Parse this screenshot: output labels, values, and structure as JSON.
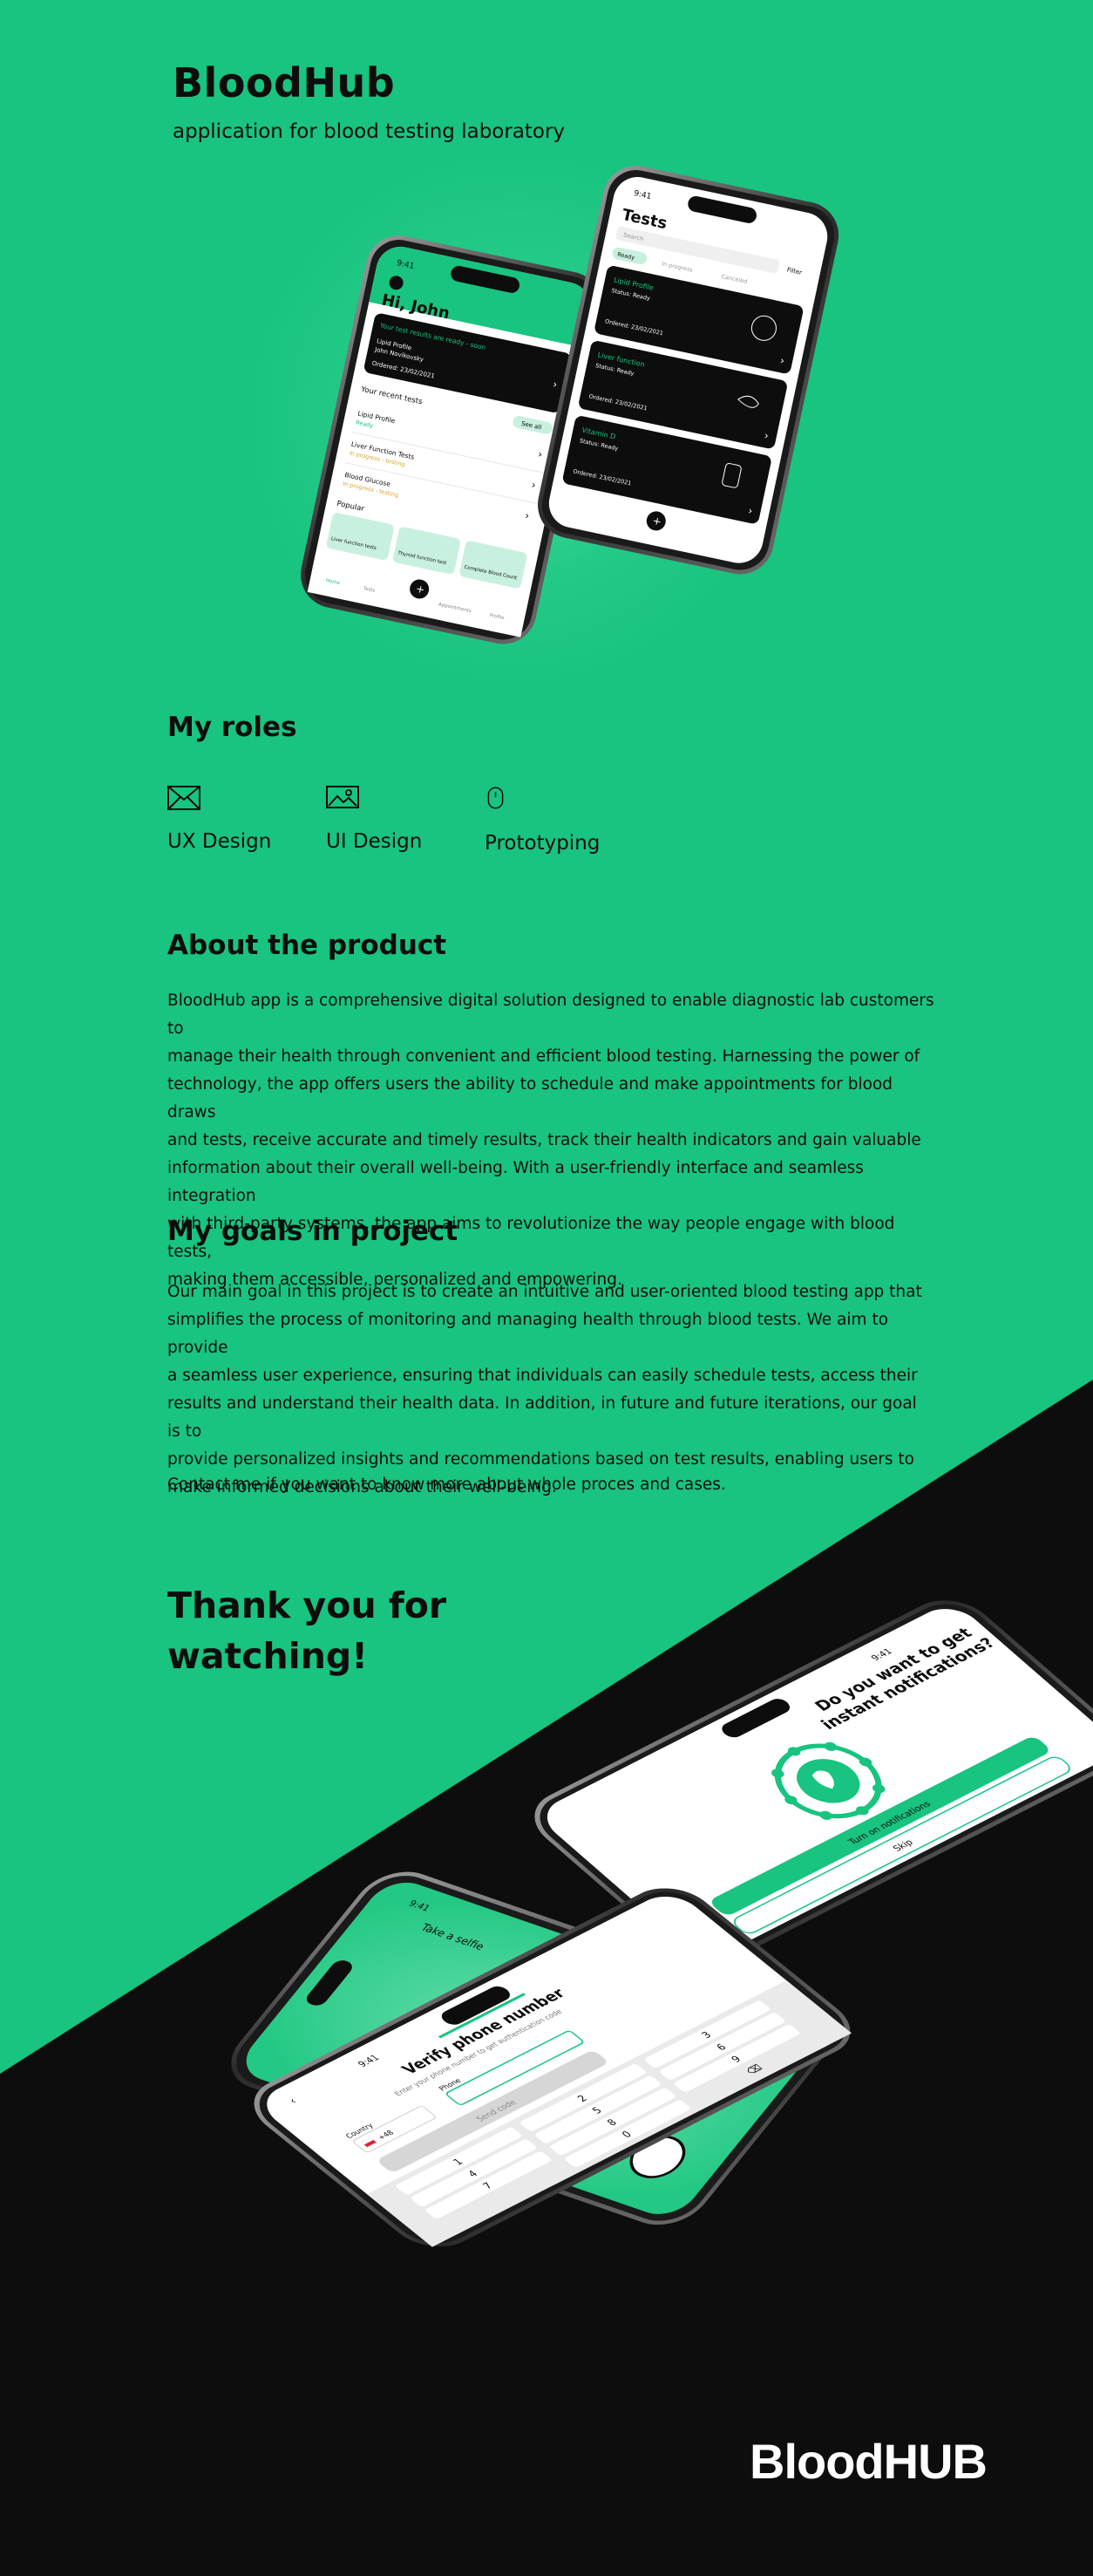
{
  "header": {
    "title": "BloodHub",
    "subtitle": "application for blood testing laboratory"
  },
  "roles": {
    "heading": "My roles",
    "items": [
      {
        "label": "UX Design",
        "icon": "envelope-icon"
      },
      {
        "label": "UI Design",
        "icon": "image-icon"
      },
      {
        "label": "Prototyping",
        "icon": "mouse-icon"
      }
    ]
  },
  "about": {
    "heading": "About the product",
    "lines": [
      "BloodHub app is a comprehensive digital solution designed to enable diagnostic lab customers to",
      "manage their health through convenient and efficient blood testing. Harnessing the power of",
      "technology, the app offers users the ability to schedule and make appointments for blood draws",
      "and tests, receive accurate and timely results, track their health indicators and gain valuable",
      "information about their overall well-being. With a user-friendly interface and seamless integration",
      "with third-party systems, the app aims to revolutionize the way people engage with blood tests,",
      "making them accessible, personalized and empowering."
    ]
  },
  "goals": {
    "heading": "My goals in project",
    "lines": [
      "Our main goal in this project is to create an intuitive and user-oriented blood testing app that",
      "simplifies the process of monitoring and managing health through blood tests. We aim to provide",
      "a seamless user experience, ensuring that individuals can easily schedule tests, access their",
      "results and understand their health data. In addition, in future and future iterations, our goal is to",
      "provide personalized insights and recommendations based on test results, enabling users to",
      "make informed decisions about their well-being."
    ],
    "contact": "Contact me if you want to know more about whole proces and cases."
  },
  "closing": {
    "thanks": "Thank you for watching!",
    "brand": "BloodHUB"
  },
  "phone_home": {
    "time": "9:41",
    "greeting": "Hi, John",
    "banner_title": "Your test results are ready - soon",
    "banner_line1": "Lipid Profile",
    "banner_line2": "John Novikovsky",
    "banner_line3": "Ordered: 23/02/2021",
    "recent_label": "Your recent tests",
    "see_all": "See all",
    "recent_items": [
      {
        "name": "Lipid Profile",
        "status": "Ready"
      },
      {
        "name": "Liver Function Tests",
        "status": "In progress - testing"
      },
      {
        "name": "Blood Glucose",
        "status": "In progress - testing"
      }
    ],
    "popular_label": "Popular",
    "popular_items": [
      "Liver function tests",
      "Thyroid function test",
      "Complete Blood Count (CBC)"
    ],
    "nav": [
      "Home",
      "Tests",
      "",
      "Appointments",
      "Profile"
    ]
  },
  "phone_tests": {
    "time": "9:41",
    "title": "Tests",
    "search_placeholder": "Search",
    "filter": "Filter",
    "tabs": [
      "Ready",
      "In progress",
      "Canceled"
    ],
    "cards": [
      {
        "name": "Lipid Profile",
        "status": "Status: Ready",
        "date": "Ordered: 23/02/2021"
      },
      {
        "name": "Liver function",
        "status": "Status: Ready",
        "date": "Ordered: 23/02/2021"
      },
      {
        "name": "Vitamin D",
        "status": "Status: Ready",
        "date": "Ordered: 23/02/2021"
      }
    ]
  },
  "phone_notify": {
    "time": "9:41",
    "title": "Do you want to get instant notifications?",
    "primary_button": "Turn on notifications",
    "secondary_button": "Skip"
  },
  "phone_selfie": {
    "time": "9:41",
    "title": "Take a selfie"
  },
  "phone_verify": {
    "time": "9:41",
    "title": "Verify phone number",
    "subtitle": "Enter your phone number to get authentication code",
    "country_label": "Country",
    "country_code": "+48",
    "phone_label": "Phone",
    "send_button": "Send code",
    "keys": [
      "1",
      "2",
      "3",
      "4",
      "5",
      "6",
      "7",
      "8",
      "9",
      "",
      "0",
      "⌫"
    ]
  },
  "colors": {
    "brand_green": "#18c47f",
    "dark": "#0d0d0d",
    "white": "#ffffff"
  }
}
